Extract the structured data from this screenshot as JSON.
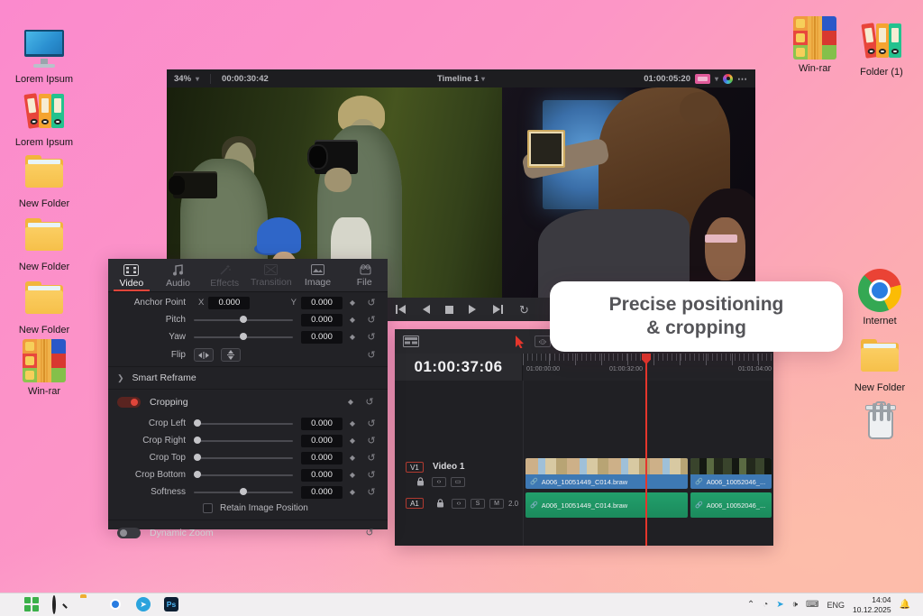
{
  "desktop": {
    "icons_left": [
      {
        "icon": "monitor",
        "label": "Lorem Ipsum"
      },
      {
        "icon": "binders",
        "label": "Lorem Ipsum"
      },
      {
        "icon": "folder",
        "label": "New Folder"
      },
      {
        "icon": "folder",
        "label": "New Folder"
      },
      {
        "icon": "folder",
        "label": "New Folder"
      },
      {
        "icon": "winrar",
        "label": "Win-rar"
      }
    ],
    "icons_top_right": [
      {
        "icon": "winrar",
        "label": "Win-rar"
      },
      {
        "icon": "binders",
        "label": "Folder (1)"
      }
    ],
    "icons_right": [
      {
        "icon": "chrome",
        "label": "Internet"
      },
      {
        "icon": "folder",
        "label": "New Folder"
      },
      {
        "icon": "trash",
        "label": ""
      }
    ]
  },
  "viewer": {
    "zoom_level": "34%",
    "clip_timecode": "00:00:30:42",
    "timeline_name": "Timeline 1",
    "timecode": "01:00:05:20"
  },
  "inspector": {
    "tabs": [
      {
        "label": "Video"
      },
      {
        "label": "Audio"
      },
      {
        "label": "Effects"
      },
      {
        "label": "Transition"
      },
      {
        "label": "Image"
      },
      {
        "label": "File"
      }
    ],
    "anchor": {
      "label": "Anchor Point",
      "x_label": "X",
      "x_value": "0.000",
      "y_label": "Y",
      "y_value": "0.000"
    },
    "pitch": {
      "label": "Pitch",
      "value": "0.000"
    },
    "yaw": {
      "label": "Yaw",
      "value": "0.000"
    },
    "flip_label": "Flip",
    "smart_reframe_label": "Smart Reframe",
    "cropping_label": "Cropping",
    "crop_rows": [
      {
        "label": "Crop Left",
        "value": "0.000"
      },
      {
        "label": "Crop Right",
        "value": "0.000"
      },
      {
        "label": "Crop Top",
        "value": "0.000"
      },
      {
        "label": "Crop Bottom",
        "value": "0.000"
      },
      {
        "label": "Softness",
        "value": "0.000"
      }
    ],
    "retain_label": "Retain Image Position",
    "dynamic_zoom_label": "Dynamic Zoom"
  },
  "timeline": {
    "timecode": "01:00:37:06",
    "ruler_labels": [
      "01:00:00:00",
      "01:00:32:00",
      "01:01:04:00"
    ],
    "video_track": {
      "badge": "V1",
      "name": "Video 1"
    },
    "audio_track": {
      "badge": "A1",
      "solo": "S",
      "mute": "M",
      "channels": "2.0"
    },
    "video_clips": [
      {
        "name": "A006_10051449_C014.braw"
      },
      {
        "name": "A006_10052046_..."
      }
    ],
    "audio_clips": [
      {
        "name": "A006_10051449_C014.braw"
      },
      {
        "name": "A006_10052046_..."
      }
    ]
  },
  "callout": {
    "line1": "Precise positioning",
    "line2": "& cropping"
  },
  "taskbar": {
    "language": "ENG",
    "time": "14:04",
    "date": "10.12.2025"
  },
  "colors": {
    "accent_red": "#e0453a",
    "clip_blue": "#3e79b4",
    "clip_green": "#1f9e68",
    "desktop_pink": "#fb8acd",
    "desktop_salmon": "#fdb6a6"
  }
}
